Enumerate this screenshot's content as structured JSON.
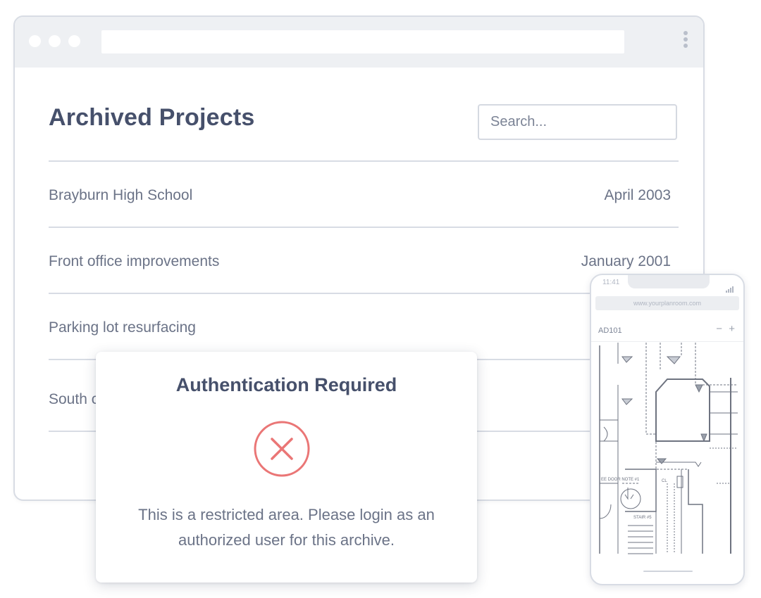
{
  "browser": {
    "title": "Archived Projects",
    "search": {
      "placeholder": "Search...",
      "value": ""
    },
    "projects": [
      {
        "name": "Brayburn High School",
        "date": "April 2003"
      },
      {
        "name": "Front office improvements",
        "date": "January 2001"
      },
      {
        "name": "Parking lot resurfacing",
        "date": ""
      },
      {
        "name": "South c",
        "date": ""
      }
    ]
  },
  "modal": {
    "title": "Authentication Required",
    "icon": "close-circle-icon",
    "message": "This is a restricted area. Please login as an authorized user for this archive."
  },
  "phone": {
    "time": "11:41",
    "url": "www.yourplanroom.com",
    "sheet": "AD101",
    "zoom_out": "−",
    "zoom_in": "+",
    "plan_labels": {
      "stair": "STAIR #5",
      "cl": "CL",
      "door_note": "EE DOOR NOTE #1"
    }
  },
  "colors": {
    "heading": "#46506b",
    "text": "#6b7387",
    "divider": "#d8dce4",
    "error": "#ea7676"
  }
}
